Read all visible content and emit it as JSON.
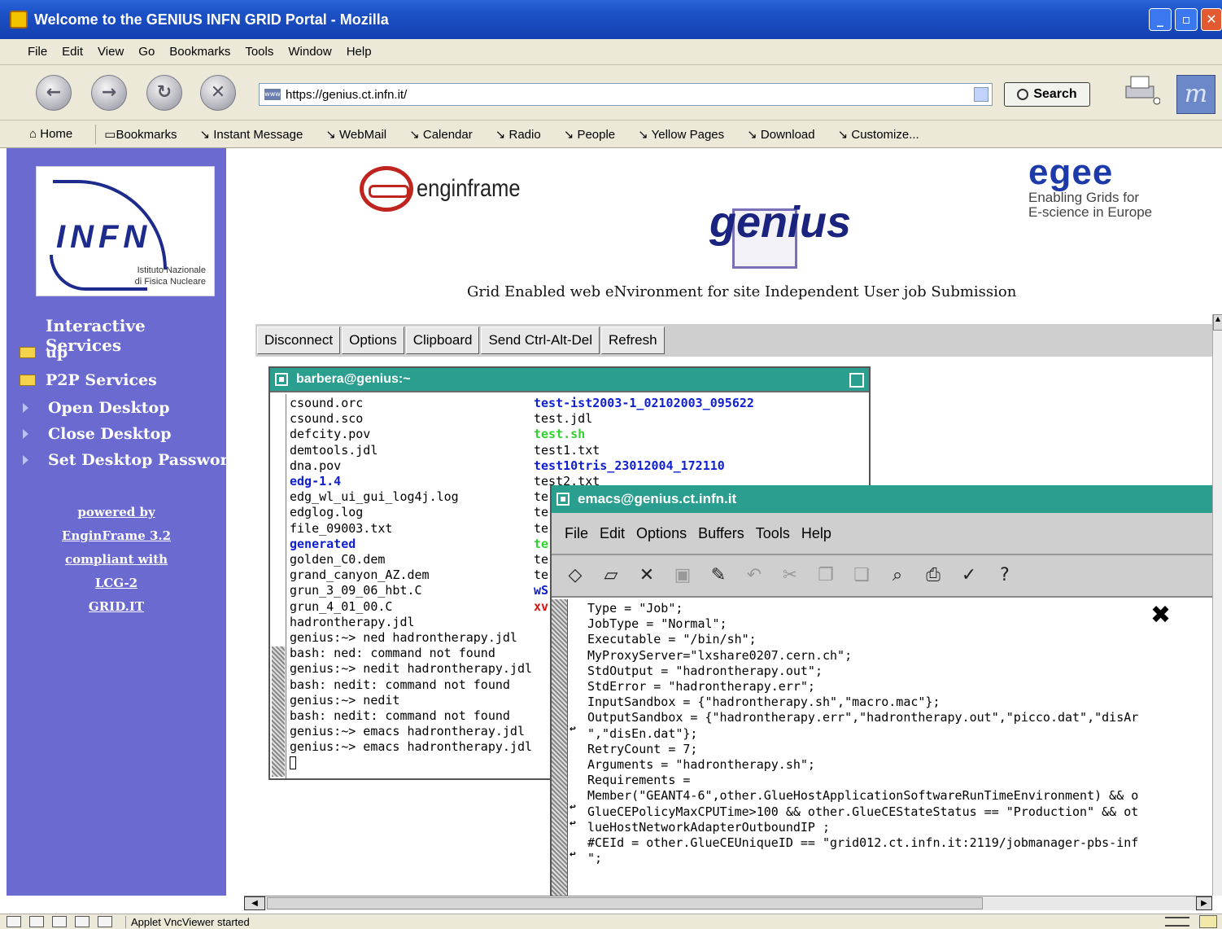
{
  "window": {
    "title": "Welcome to the GENIUS INFN GRID Portal - Mozilla"
  },
  "menubar": [
    "File",
    "Edit",
    "View",
    "Go",
    "Bookmarks",
    "Tools",
    "Window",
    "Help"
  ],
  "navbar": {
    "url": "https://genius.ct.infn.it/",
    "search_label": "Search"
  },
  "personal_toolbar": [
    "Home",
    "Bookmarks",
    "Instant Message",
    "WebMail",
    "Calendar",
    "Radio",
    "People",
    "Yellow Pages",
    "Download",
    "Customize..."
  ],
  "sidebar": {
    "logo_text": "INFN",
    "logo_sub_1": "Istituto Nazionale",
    "logo_sub_2": "di Fisica Nucleare",
    "heading": "Interactive Services",
    "items": [
      "up",
      "P2P Services",
      "Open Desktop",
      "Close Desktop",
      "Set Desktop Password"
    ],
    "powered": [
      "powered by",
      "EnginFrame 3.2",
      "compliant with",
      "LCG-2",
      "GRID.IT"
    ]
  },
  "header": {
    "enginframe": "enginframe",
    "genius": "genius",
    "egee_logo": "egee",
    "egee_sub_1": "Enabling Grids for",
    "egee_sub_2": "E-science in Europe",
    "tagline": "Grid Enabled web eNvironment for site Independent User job Submission"
  },
  "vnc_toolbar": [
    "Disconnect",
    "Options",
    "Clipboard",
    "Send Ctrl-Alt-Del",
    "Refresh"
  ],
  "xterm": {
    "title": "barbera@genius:~",
    "col1": [
      {
        "t": "csound.orc",
        "c": ""
      },
      {
        "t": "csound.sco",
        "c": ""
      },
      {
        "t": "defcity.pov",
        "c": ""
      },
      {
        "t": "demtools.jdl",
        "c": ""
      },
      {
        "t": "dna.pov",
        "c": ""
      },
      {
        "t": "edg-1.4",
        "c": "blue"
      },
      {
        "t": "edg_wl_ui_gui_log4j.log",
        "c": ""
      },
      {
        "t": "edglog.log",
        "c": ""
      },
      {
        "t": "file_09003.txt",
        "c": ""
      },
      {
        "t": "generated",
        "c": "blue"
      },
      {
        "t": "golden_C0.dem",
        "c": ""
      },
      {
        "t": "grand_canyon_AZ.dem",
        "c": ""
      },
      {
        "t": "grun_3_09_06_hbt.C",
        "c": ""
      },
      {
        "t": "grun_4_01_00.C",
        "c": ""
      },
      {
        "t": "hadrontherapy.jdl",
        "c": ""
      },
      {
        "t": "genius:~> ned hadrontherapy.jdl",
        "c": ""
      },
      {
        "t": "bash: ned: command not found",
        "c": ""
      },
      {
        "t": "genius:~> nedit hadrontherapy.jdl",
        "c": ""
      },
      {
        "t": "bash: nedit: command not found",
        "c": ""
      },
      {
        "t": "genius:~> nedit",
        "c": ""
      },
      {
        "t": "bash: nedit: command not found",
        "c": ""
      },
      {
        "t": "genius:~> emacs hadrontheray.jdl",
        "c": ""
      },
      {
        "t": "genius:~> emacs hadrontherapy.jdl",
        "c": ""
      }
    ],
    "col2": [
      {
        "t": "test-ist2003-1_02102003_095622",
        "c": "blue"
      },
      {
        "t": "test.jdl",
        "c": ""
      },
      {
        "t": "test.sh",
        "c": "green"
      },
      {
        "t": "test1.txt",
        "c": ""
      },
      {
        "t": "test10tris_23012004_172110",
        "c": "blue"
      },
      {
        "t": "test2.txt",
        "c": ""
      },
      {
        "t": "te",
        "c": ""
      },
      {
        "t": "te",
        "c": ""
      },
      {
        "t": "te",
        "c": ""
      },
      {
        "t": "te",
        "c": "green"
      },
      {
        "t": "te",
        "c": ""
      },
      {
        "t": "te",
        "c": ""
      },
      {
        "t": "wS",
        "c": "blue"
      },
      {
        "t": "xv",
        "c": "red"
      }
    ]
  },
  "emacs": {
    "title": "emacs@genius.ct.infn.it",
    "menu": [
      "File",
      "Edit",
      "Options",
      "Buffers",
      "Tools",
      "Help"
    ],
    "lines": [
      "Type = \"Job\";",
      "JobType = \"Normal\";",
      "Executable = \"/bin/sh\";",
      "MyProxyServer=\"lxshare0207.cern.ch\";",
      "StdOutput = \"hadrontherapy.out\";",
      "StdError = \"hadrontherapy.err\";",
      "InputSandbox = {\"hadrontherapy.sh\",\"macro.mac\"};",
      "OutputSandbox = {\"hadrontherapy.err\",\"hadrontherapy.out\",\"picco.dat\",\"disAr",
      "\",\"disEn.dat\"};",
      "RetryCount = 7;",
      "Arguments = \"hadrontherapy.sh\";",
      "Requirements =",
      "Member(\"GEANT4-6\",other.GlueHostApplicationSoftwareRunTimeEnvironment) && o",
      "GlueCEPolicyMaxCPUTime>100 && other.GlueCEStateStatus == \"Production\" && ot",
      "lueHostNetworkAdapterOutboundIP ;",
      "#CEId = other.GlueCEUniqueID == \"grid012.ct.infn.it:2119/jobmanager-pbs-inf",
      "\";"
    ]
  },
  "status": {
    "text": "Applet VncViewer started"
  }
}
